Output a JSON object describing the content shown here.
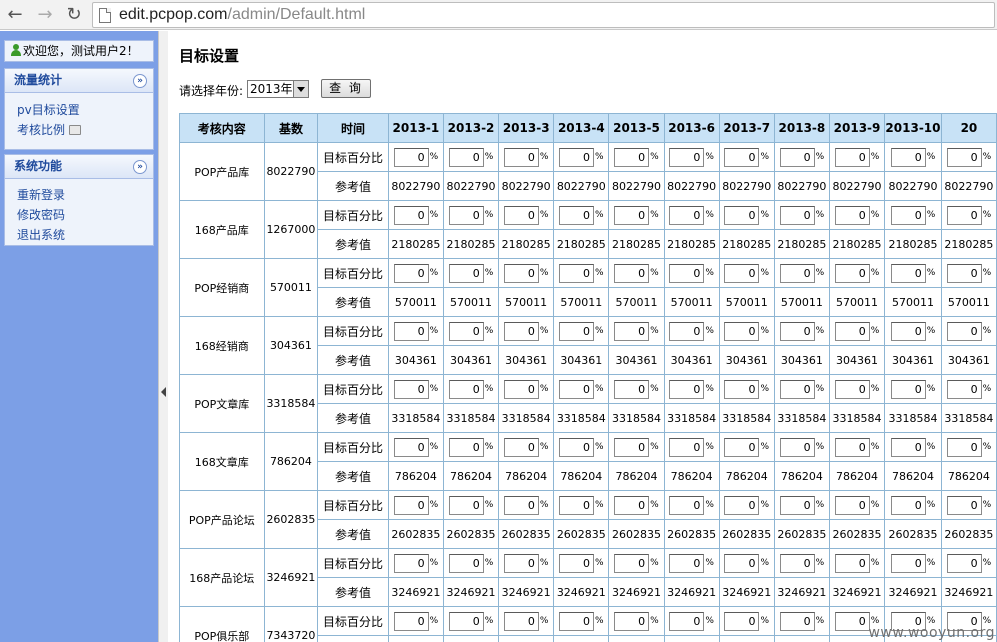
{
  "browser": {
    "url_host": "edit.pcpop.com",
    "url_path": "/admin/Default.html"
  },
  "sidebar": {
    "welcome": "欢迎您，测试用户2！",
    "panels": [
      {
        "title": "流量统计",
        "items": [
          "pv目标设置",
          "考核比例"
        ]
      },
      {
        "title": "系统功能",
        "items": [
          "重新登录",
          "修改密码",
          "退出系统"
        ]
      }
    ]
  },
  "main": {
    "title": "目标设置",
    "year_label": "请选择年份:",
    "year_value": "2013年",
    "query_button": "查 询",
    "headers": [
      "考核内容",
      "基数",
      "时间",
      "2013-1",
      "2013-2",
      "2013-3",
      "2013-4",
      "2013-5",
      "2013-6",
      "2013-7",
      "2013-8",
      "2013-9",
      "2013-10",
      "20"
    ],
    "row_label_pct": "目标百分比",
    "row_label_ref": "参考值",
    "pct_value": "0",
    "pct_sign": "%",
    "rows": [
      {
        "name": "POP产品库",
        "base": "8022790",
        "ref": "8022790"
      },
      {
        "name": "168产品库",
        "base": "1267000",
        "ref": "2180285"
      },
      {
        "name": "POP经销商",
        "base": "570011",
        "ref": "570011"
      },
      {
        "name": "168经销商",
        "base": "304361",
        "ref": "304361"
      },
      {
        "name": "POP文章库",
        "base": "3318584",
        "ref": "3318584"
      },
      {
        "name": "168文章库",
        "base": "786204",
        "ref": "786204"
      },
      {
        "name": "POP产品论坛",
        "base": "2602835",
        "ref": "2602835"
      },
      {
        "name": "168产品论坛",
        "base": "3246921",
        "ref": "3246921"
      },
      {
        "name": "POP俱乐部",
        "base": "7343720",
        "ref": ""
      }
    ]
  },
  "watermark": "www.wooyun.org"
}
